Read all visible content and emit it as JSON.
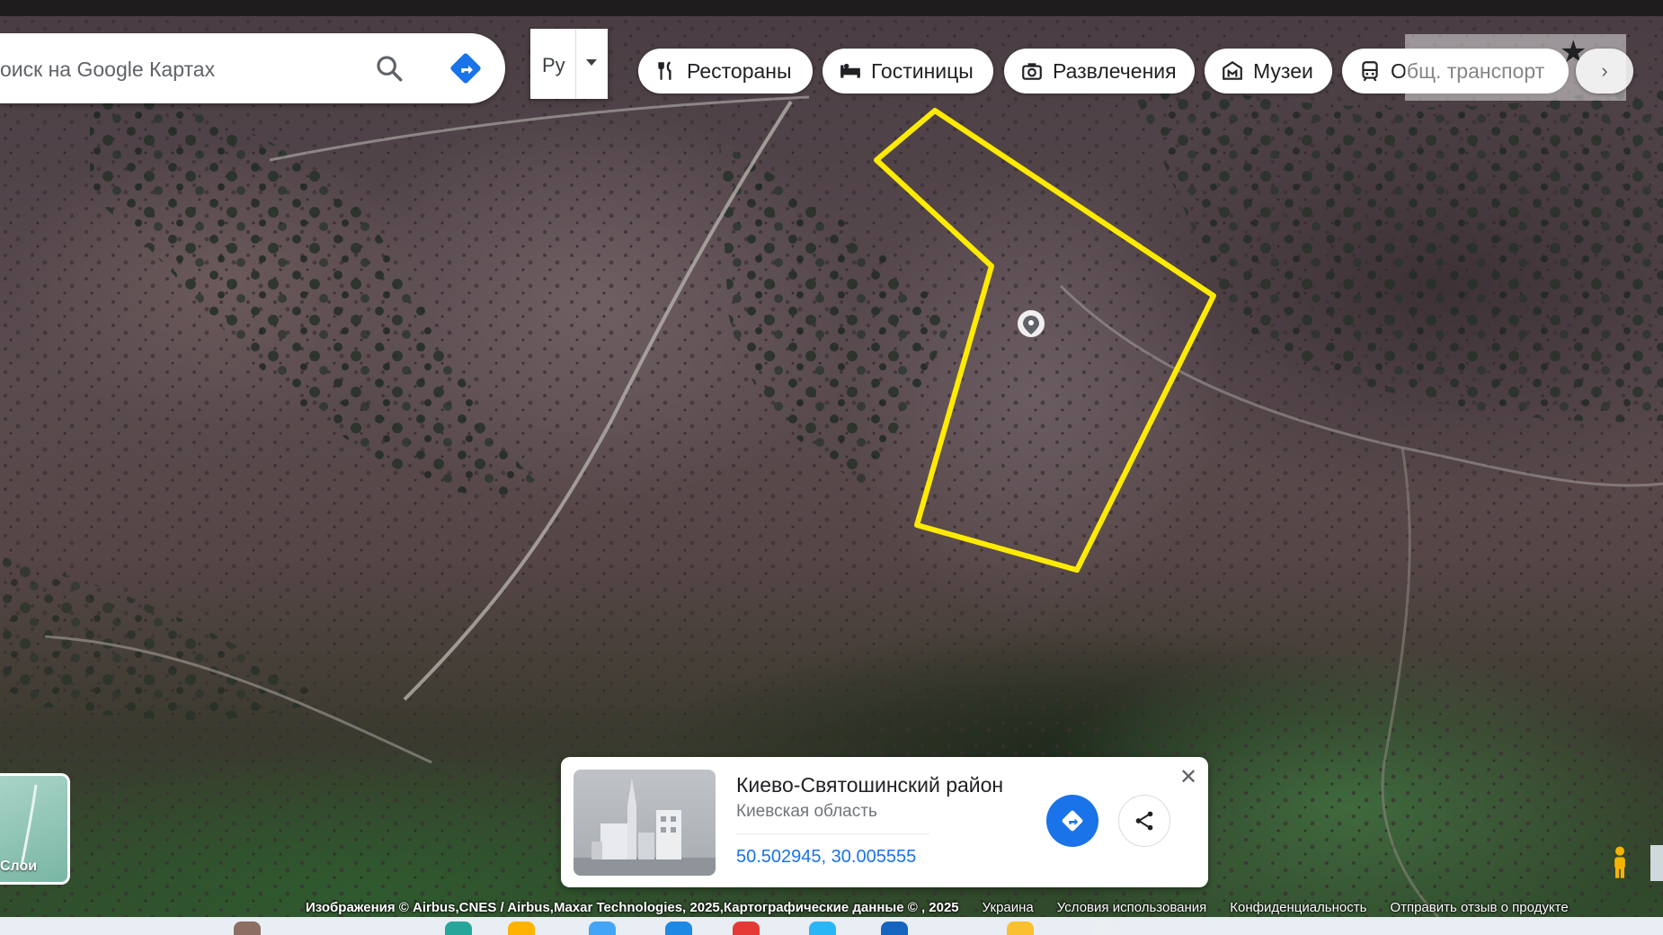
{
  "search": {
    "placeholder": "оиск на Google Картах"
  },
  "language": {
    "selected": "Ру"
  },
  "chips": [
    {
      "label": "Рестораны",
      "icon": "restaurant-icon"
    },
    {
      "label": "Гостиницы",
      "icon": "hotel-icon"
    },
    {
      "label": "Развлечения",
      "icon": "camera-icon"
    },
    {
      "label": "Музеи",
      "icon": "museum-icon"
    },
    {
      "label": "Общ. транспорт",
      "icon": "transit-icon"
    }
  ],
  "place_card": {
    "title": "Киево-Святошинский район",
    "subtitle": "Киевская область",
    "coordinates": "50.502945, 30.005555"
  },
  "layers": {
    "label": "Слои"
  },
  "footer": {
    "attribution": "Изображения © Airbus,CNES / Airbus,Maxar Technologies, 2025,Картографические данные © , 2025",
    "country": "Украина",
    "terms": "Условия использования",
    "privacy": "Конфиденциальность",
    "feedback": "Отправить отзыв о продукте"
  },
  "colors": {
    "outline": "#ffeb00",
    "accent": "#1a73e8"
  }
}
